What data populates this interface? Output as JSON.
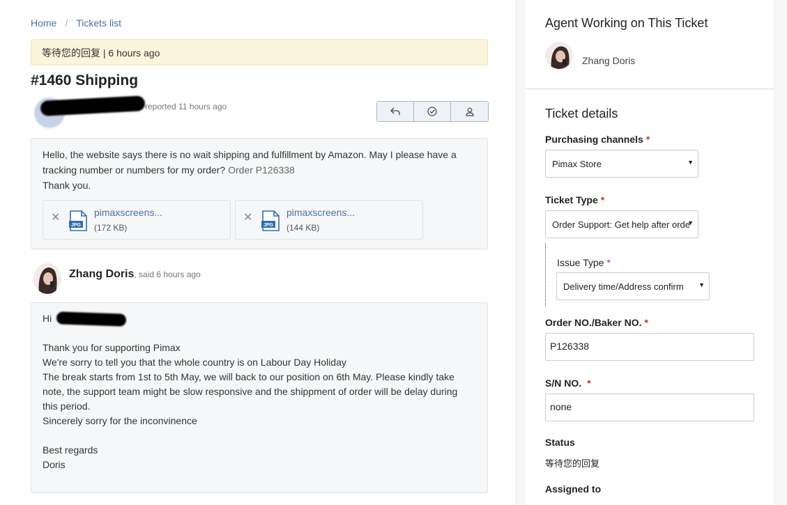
{
  "breadcrumb": {
    "home": "Home",
    "separator": "/",
    "list": "Tickets list"
  },
  "status_bar": {
    "text": "等待您的回复 | 6 hours ago"
  },
  "ticket": {
    "title": "#1460 Shipping"
  },
  "reporter": {
    "meta": "reported 11 hours ago"
  },
  "actions": {
    "icons": [
      "reply-icon",
      "resolve-check-icon",
      "assign-user-icon"
    ]
  },
  "message1": {
    "line1": "Hello, the website says there is no wait shipping and fulfillment by Amazon. May I please have a",
    "line2_a": "tracking number or numbers for my order? ",
    "line2_b": "Order P126338",
    "line3": "Thank you.",
    "attachments": [
      {
        "name": "pimaxscreens...",
        "size": "(172 KB)",
        "type": "JPG"
      },
      {
        "name": "pimaxscreens...",
        "size": "(144 KB)",
        "type": "JPG"
      }
    ]
  },
  "reply": {
    "author": "Zhang Doris",
    "said": ", said 6 hours ago",
    "greeting": "Hi",
    "lines": [
      "Thank you for supporting Pimax",
      "We're sorry to tell you that the whole country is on Labour Day Holiday",
      "The break starts from 1st to 5th May, we will back to our position on 6th May. Please kindly take",
      "note, the support team might be slow responsive and the shippment of order will be delay during",
      "this period.",
      "Sincerely sorry for the inconvinence"
    ],
    "closing": "Best regards",
    "signature": "Doris"
  },
  "sidebar": {
    "agent_heading": "Agent Working on This Ticket",
    "agent_name": "Zhang Doris",
    "details_heading": "Ticket details",
    "purchasing_label": "Purchasing channels",
    "purchasing_value": "Pimax Store",
    "ticket_type_label": "Ticket Type",
    "ticket_type_value": "Order Support: Get help after orde",
    "issue_type_label": "Issue Type",
    "issue_type_value": "Delivery time/Address confirm",
    "order_label": "Order NO./Baker NO.",
    "order_value": "P126338",
    "sn_label": "S/N NO.",
    "sn_value": "none",
    "status_label": "Status",
    "status_value": "等待您的回复",
    "assigned_label": "Assigned to",
    "required_mark": "*",
    "caret": "▼"
  },
  "colors": {
    "link": "#4a6fa5",
    "status_bg": "#fbf5dc",
    "required": "#c0392b"
  }
}
